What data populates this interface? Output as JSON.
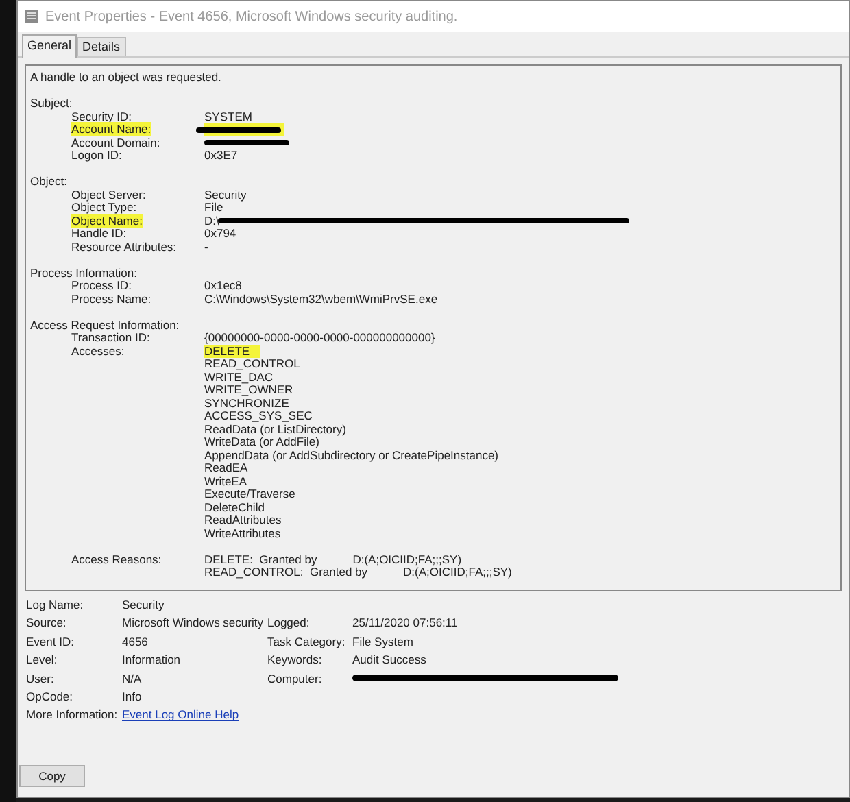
{
  "window": {
    "title": "Event Properties - Event 4656, Microsoft Windows security auditing."
  },
  "tabs": [
    {
      "label": "General",
      "selected": true
    },
    {
      "label": "Details",
      "selected": false
    }
  ],
  "description": {
    "summary": "A handle to an object was requested.",
    "sections": [
      {
        "heading": "Subject:",
        "fields": [
          {
            "label": "Security ID:",
            "label_highlighted": false,
            "values": [
              {
                "text": "SYSTEM",
                "highlighted": false
              }
            ]
          },
          {
            "label": "Account Name:",
            "label_highlighted": true,
            "values": [
              {
                "highlighted": true,
                "redacted": true
              }
            ]
          },
          {
            "label": "Account Domain:",
            "label_highlighted": false,
            "values": [
              {
                "highlighted": false,
                "redacted": true
              }
            ]
          },
          {
            "label": "Logon ID:",
            "label_highlighted": false,
            "values": [
              {
                "text": "0x3E7",
                "highlighted": false
              }
            ]
          }
        ]
      },
      {
        "heading": "Object:",
        "fields": [
          {
            "label": "Object Server:",
            "label_highlighted": false,
            "values": [
              {
                "text": "Security",
                "highlighted": false
              }
            ]
          },
          {
            "label": "Object Type:",
            "label_highlighted": false,
            "values": [
              {
                "text": "File",
                "highlighted": false
              }
            ]
          },
          {
            "label": "Object Name:",
            "label_highlighted": true,
            "values": [
              {
                "text": "D:\\",
                "highlighted": false,
                "redacted": true
              }
            ]
          },
          {
            "label": "Handle ID:",
            "label_highlighted": false,
            "values": [
              {
                "text": "0x794",
                "highlighted": false
              }
            ]
          },
          {
            "label": "Resource Attributes:",
            "label_highlighted": false,
            "values": [
              {
                "text": "-",
                "highlighted": false
              }
            ]
          }
        ]
      },
      {
        "heading": "Process Information:",
        "fields": [
          {
            "label": "Process ID:",
            "label_highlighted": false,
            "values": [
              {
                "text": "0x1ec8",
                "highlighted": false
              }
            ]
          },
          {
            "label": "Process Name:",
            "label_highlighted": false,
            "values": [
              {
                "text": "C:\\Windows\\System32\\wbem\\WmiPrvSE.exe",
                "highlighted": false
              }
            ]
          }
        ]
      },
      {
        "heading": "Access Request Information:",
        "fields": [
          {
            "label": "Transaction ID:",
            "label_highlighted": false,
            "values": [
              {
                "text": "{00000000-0000-0000-0000-000000000000}",
                "highlighted": false
              }
            ]
          },
          {
            "label": "Accesses:",
            "label_highlighted": false,
            "values": [
              {
                "text": "DELETE",
                "highlighted": true
              },
              {
                "text": "READ_CONTROL",
                "highlighted": false
              },
              {
                "text": "WRITE_DAC",
                "highlighted": false
              },
              {
                "text": "WRITE_OWNER",
                "highlighted": false
              },
              {
                "text": "SYNCHRONIZE",
                "highlighted": false
              },
              {
                "text": "ACCESS_SYS_SEC",
                "highlighted": false
              },
              {
                "text": "ReadData (or ListDirectory)",
                "highlighted": false
              },
              {
                "text": "WriteData (or AddFile)",
                "highlighted": false
              },
              {
                "text": "AppendData (or AddSubdirectory or CreatePipeInstance)",
                "highlighted": false
              },
              {
                "text": "ReadEA",
                "highlighted": false
              },
              {
                "text": "WriteEA",
                "highlighted": false
              },
              {
                "text": "Execute/Traverse",
                "highlighted": false
              },
              {
                "text": "DeleteChild",
                "highlighted": false
              },
              {
                "text": "ReadAttributes",
                "highlighted": false
              },
              {
                "text": "WriteAttributes",
                "highlighted": false
              }
            ],
            "gap_after": true
          },
          {
            "label": "Access Reasons:",
            "label_highlighted": false,
            "values": [
              {
                "text": "DELETE:  Granted by",
                "grant": "D:(A;OICIID;FA;;;SY)",
                "highlighted": false
              },
              {
                "text": "READ_CONTROL:  Granted by",
                "grant": "D:(A;OICIID;FA;;;SY)",
                "highlighted": false
              }
            ]
          }
        ]
      }
    ]
  },
  "details": {
    "left": [
      {
        "label": "Log Name:",
        "value": "Security"
      },
      {
        "label": "Source:",
        "value": "Microsoft Windows security"
      },
      {
        "label": "Event ID:",
        "value": "4656"
      },
      {
        "label": "Level:",
        "value": "Information"
      },
      {
        "label": "User:",
        "value": "N/A"
      },
      {
        "label": "OpCode:",
        "value": "Info"
      },
      {
        "label": "More Information:",
        "link": "Event Log Online Help"
      }
    ],
    "right": [
      {
        "label": "Logged:",
        "value": "25/11/2020 07:56:11"
      },
      {
        "label": "Task Category:",
        "value": "File System"
      },
      {
        "label": "Keywords:",
        "value": "Audit Success"
      },
      {
        "label": "Computer:",
        "redacted": true
      }
    ]
  },
  "buttons": [
    {
      "label": "Copy"
    }
  ]
}
